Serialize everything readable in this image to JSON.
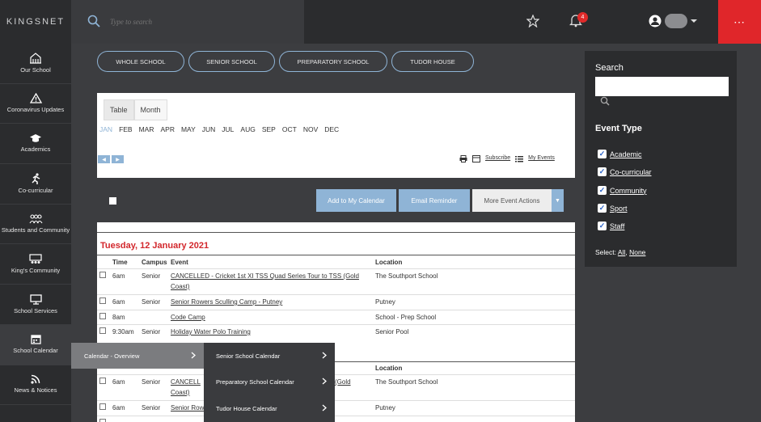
{
  "header": {
    "logo": "KINGSNET",
    "search_placeholder": "Type to search",
    "notification_count": "4",
    "menu_label": "⋯"
  },
  "sidebar": {
    "items": [
      {
        "label": "Our School",
        "icon": "building-icon"
      },
      {
        "label": "Coronavirus Updates",
        "icon": "warning-icon"
      },
      {
        "label": "Academics",
        "icon": "graduation-cap-icon"
      },
      {
        "label": "Co-curricular",
        "icon": "runner-icon"
      },
      {
        "label": "Students and Community",
        "icon": "people-icon"
      },
      {
        "label": "King's Community",
        "icon": "community-icon"
      },
      {
        "label": "School Services",
        "icon": "monitor-icon"
      },
      {
        "label": "School Calendar",
        "icon": "calendar-icon"
      },
      {
        "label": "News & Notices",
        "icon": "rss-icon"
      }
    ]
  },
  "filters": [
    "WHOLE SCHOOL",
    "SENIOR SCHOOL",
    "PREPARATORY SCHOOL",
    "TUDOR HOUSE"
  ],
  "calendar": {
    "tabs": [
      "Table",
      "Month"
    ],
    "months": [
      "JAN",
      "FEB",
      "MAR",
      "APR",
      "MAY",
      "JUN",
      "JUL",
      "AUG",
      "SEP",
      "OCT",
      "NOV",
      "DEC"
    ],
    "tools": {
      "subscribe": "Subscribe",
      "my_events": "My Events"
    },
    "actions": {
      "add": "Add to My Calendar",
      "email": "Email Reminder",
      "more": "More Event Actions"
    },
    "day_heading": "Tuesday, 12 January 2021",
    "columns": {
      "time": "Time",
      "campus": "Campus",
      "event": "Event",
      "location": "Location"
    },
    "rows": [
      {
        "time": "6am",
        "campus": "Senior",
        "event": "CANCELLED - Cricket 1st XI TSS Quad Series Tour to TSS (Gold",
        "event2": "Coast)",
        "location": "The Southport School"
      },
      {
        "time": "6am",
        "campus": "Senior",
        "event": "Senior Rowers Sculling Camp - Putney",
        "location": "Putney"
      },
      {
        "time": "8am",
        "campus": "",
        "event": "Code Camp",
        "location": "School - Prep School"
      },
      {
        "time": "9:30am",
        "campus": "Senior",
        "event": "Holiday Water Polo Training",
        "location": "Senior Pool"
      }
    ],
    "rows2": [
      {
        "time": "6am",
        "campus": "Senior",
        "event": "CANCELL",
        "event_tail": "(Gold",
        "event2": "Coast)",
        "location": "The Southport School"
      },
      {
        "time": "6am",
        "campus": "Senior",
        "event": "Senior Row",
        "location": "Putney"
      }
    ]
  },
  "flyout": {
    "primary": "Calendar - Overview",
    "items": [
      "Senior School Calendar",
      "Preparatory School Calendar",
      "Tudor House Calendar"
    ]
  },
  "right_panel": {
    "search_label": "Search",
    "event_type_label": "Event Type",
    "types": [
      "Academic",
      "Co-curricular",
      "Community",
      "Sport",
      "Staff"
    ],
    "select_label": "Select:",
    "select_all": "All",
    "select_none": "None"
  }
}
